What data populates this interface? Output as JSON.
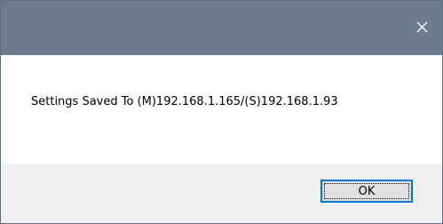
{
  "dialog": {
    "title": "",
    "close_icon": "close-icon",
    "message": "Settings Saved To (M)192.168.1.165/(S)192.168.1.93",
    "ok_label": "OK"
  },
  "colors": {
    "titlebar": "#6c7c8e",
    "footer": "#f0f0f0",
    "focus_border": "#0078d7"
  }
}
